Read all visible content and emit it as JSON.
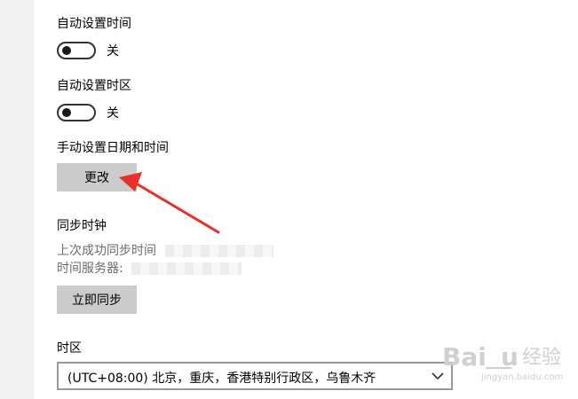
{
  "auto_time": {
    "label": "自动设置时间",
    "state": "关",
    "on": false
  },
  "auto_timezone": {
    "label": "自动设置时区",
    "state": "关",
    "on": false
  },
  "manual": {
    "label": "手动设置日期和时间",
    "button": "更改"
  },
  "sync": {
    "title": "同步时钟",
    "last_sync_label": "上次成功同步时间",
    "server_label": "时间服务器:",
    "button": "立即同步"
  },
  "timezone": {
    "label": "时区",
    "value": "(UTC+08:00) 北京，重庆，香港特别行政区，乌鲁木齐"
  },
  "annotation": {
    "color": "#e8302a"
  },
  "watermark": {
    "brand": "Bai",
    "brand2": "u",
    "cn": "经验",
    "url": "jingyan.baidu.com"
  },
  "colors": {
    "button_bg": "#cccccc",
    "sidebar_bg": "#f2f2f2",
    "secondary_text": "#6b6b6b"
  }
}
